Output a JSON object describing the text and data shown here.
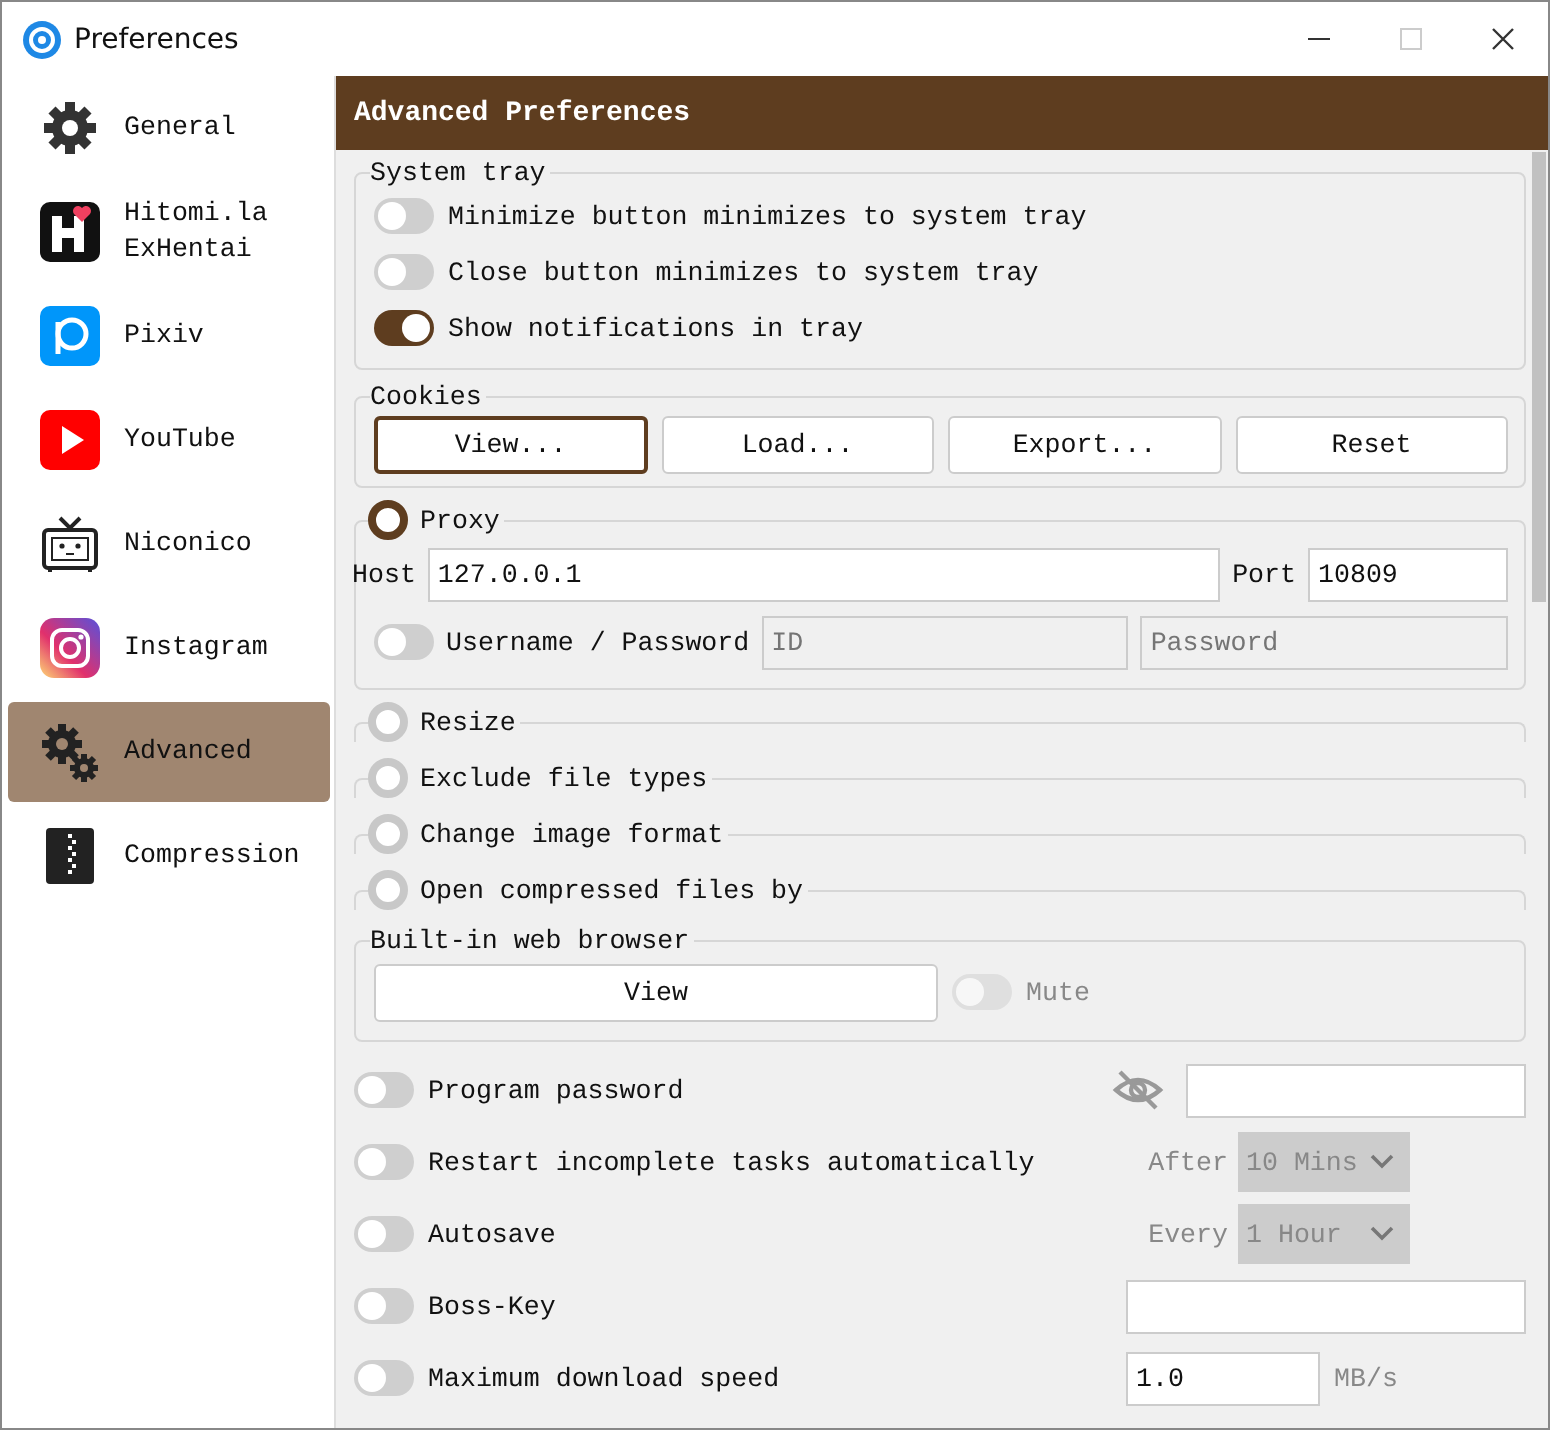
{
  "window": {
    "title": "Preferences"
  },
  "sidebar": {
    "items": [
      {
        "label": "General",
        "selected": false
      },
      {
        "label": "Hitomi.la\nExHentai",
        "selected": false
      },
      {
        "label": "Pixiv",
        "selected": false
      },
      {
        "label": "YouTube",
        "selected": false
      },
      {
        "label": "Niconico",
        "selected": false
      },
      {
        "label": "Instagram",
        "selected": false
      },
      {
        "label": "Advanced",
        "selected": true
      },
      {
        "label": "Compression",
        "selected": false
      }
    ]
  },
  "header": {
    "title": "Advanced Preferences"
  },
  "system_tray": {
    "title": "System tray",
    "options": [
      {
        "label": "Minimize button minimizes to system tray",
        "on": false
      },
      {
        "label": "Close button minimizes to system tray",
        "on": false
      },
      {
        "label": "Show notifications in tray",
        "on": true
      }
    ]
  },
  "cookies": {
    "title": "Cookies",
    "buttons": [
      {
        "label": "View...",
        "focused": true
      },
      {
        "label": "Load...",
        "focused": false
      },
      {
        "label": "Export...",
        "focused": false
      },
      {
        "label": "Reset",
        "focused": false
      }
    ]
  },
  "proxy": {
    "title": "Proxy",
    "selected": true,
    "host_label": "Host",
    "host": "127.0.0.1",
    "port_label": "Port",
    "port": "10809",
    "auth": {
      "label": "Username / Password",
      "on": false,
      "id_placeholder": "ID",
      "password_placeholder": "Password"
    }
  },
  "collapsed_sections": [
    {
      "title": "Resize",
      "selected": false
    },
    {
      "title": "Exclude file types",
      "selected": false
    },
    {
      "title": "Change image format",
      "selected": false
    },
    {
      "title": "Open compressed files by",
      "selected": false
    }
  ],
  "web_browser": {
    "title": "Built-in web browser",
    "button": "View",
    "mute": {
      "label": "Mute",
      "on": false,
      "disabled": true
    }
  },
  "settings": [
    {
      "kind": "password",
      "label": "Program password",
      "on": false
    },
    {
      "kind": "select",
      "label": "Restart incomplete tasks automatically",
      "on": false,
      "prefix": "After",
      "value": "10 Mins",
      "disabled": true
    },
    {
      "kind": "select",
      "label": "Autosave",
      "on": false,
      "prefix": "Every",
      "value": "1 Hour",
      "disabled": true
    },
    {
      "kind": "field",
      "label": "Boss-Key",
      "on": false
    },
    {
      "kind": "speed",
      "label": "Maximum download speed",
      "on": false,
      "value": "1.0",
      "unit": "MB/s"
    }
  ]
}
